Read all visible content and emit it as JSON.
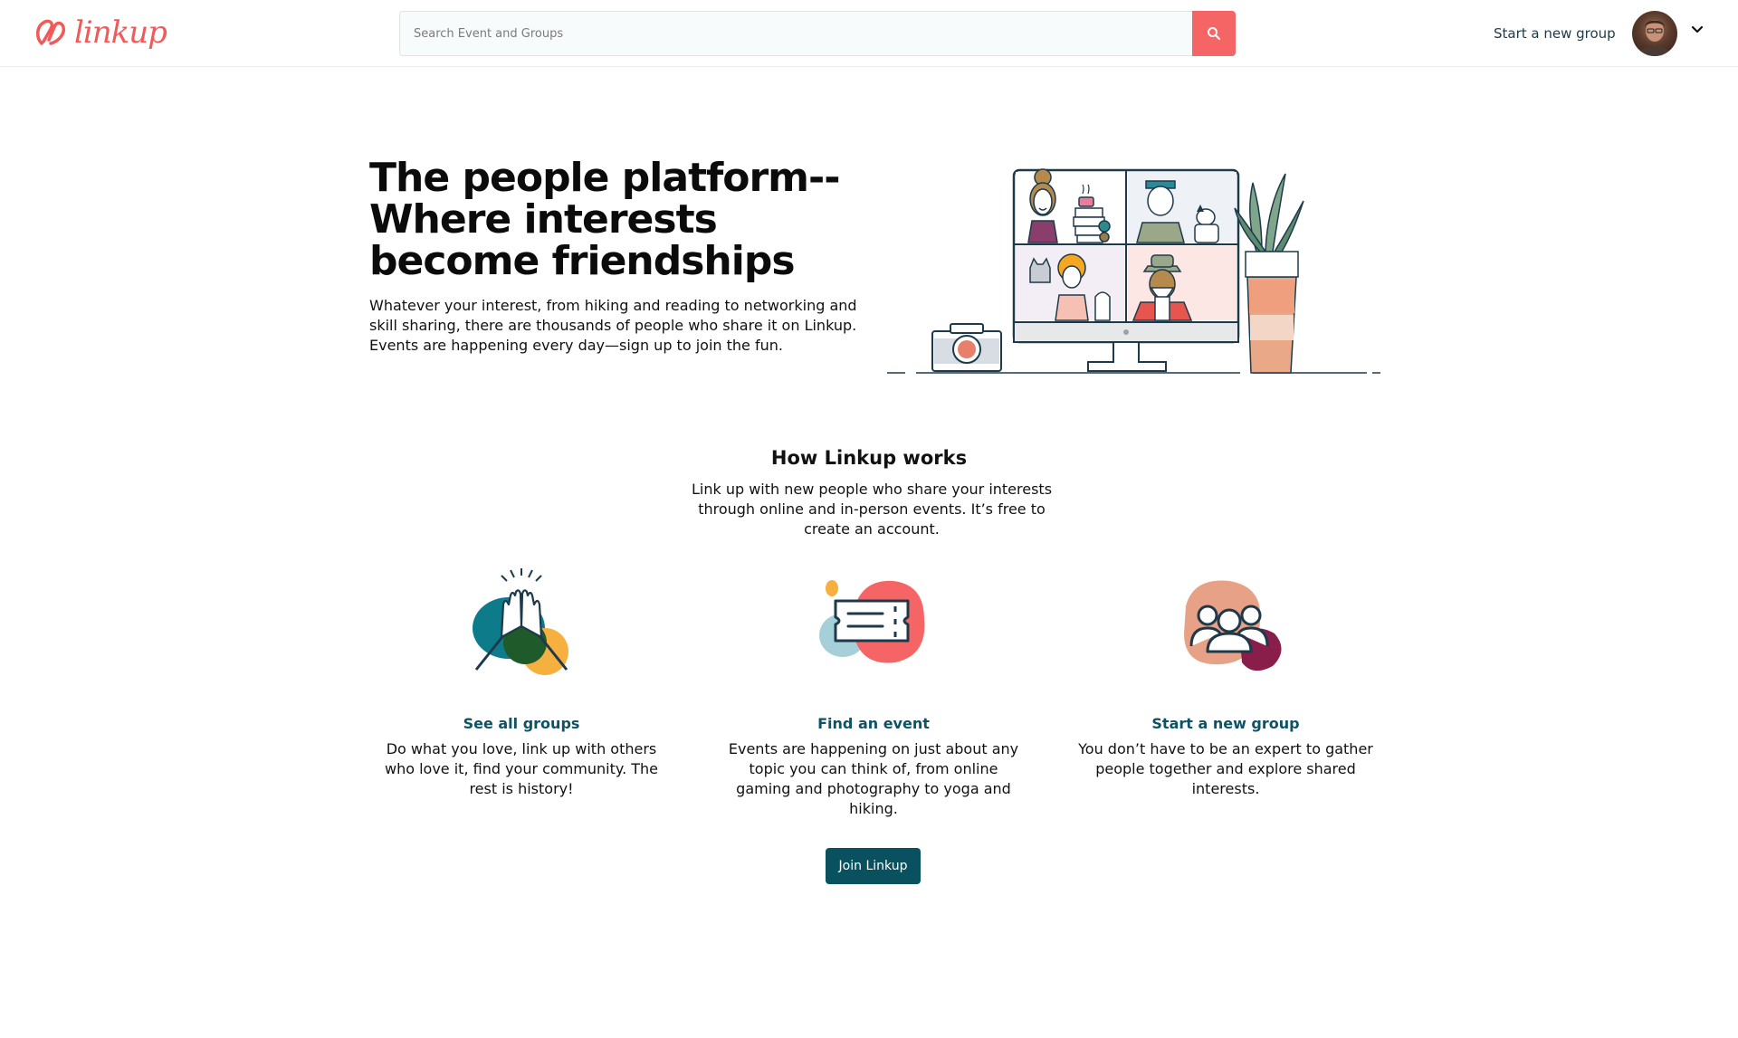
{
  "header": {
    "logo_text": "linkup",
    "search_placeholder": "Search Event and Groups",
    "start_group_label": "Start a new group"
  },
  "hero": {
    "title_lines": [
      "The people platform--",
      "Where interests",
      "become friendships"
    ],
    "subtitle": "Whatever your interest, from hiking and reading to networking and skill sharing, there are thousands of people who share it on Linkup. Events are happening every day—sign up to join the fun."
  },
  "how": {
    "title": "How Linkup works",
    "subtitle": "Link up with new people who share your interests through online and in-person events. It’s free to create an account."
  },
  "cards": [
    {
      "title": "See all groups",
      "text": "Do what you love, link up with others who love it, find your community. The rest is history!"
    },
    {
      "title": "Find an event",
      "text": "Events are happening on just about any topic you can think of, from online gaming and photography to yoga and hiking."
    },
    {
      "title": "Start a new group",
      "text": "You don’t have to be an expert to gather people together and explore shared interests."
    }
  ],
  "cta": {
    "join_label": "Join Linkup"
  },
  "colors": {
    "brand": "#f25a5a",
    "accent": "#0a5160",
    "link": "#0e5265"
  },
  "icons": [
    "linkup-logo-icon",
    "search-icon",
    "chevron-down-icon",
    "high-five-icon",
    "ticket-icon",
    "people-group-icon"
  ]
}
